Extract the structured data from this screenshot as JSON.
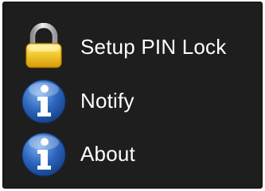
{
  "menu": {
    "items": [
      {
        "label": "Setup PIN Lock",
        "icon": "lock-icon"
      },
      {
        "label": "Notify",
        "icon": "info-icon"
      },
      {
        "label": "About",
        "icon": "info-icon"
      }
    ]
  },
  "colors": {
    "background": "#1e1e1e",
    "text": "#ffffff",
    "lock_body": "#f3c316",
    "lock_shackle": "#c9c9c9",
    "info_circle": "#2f67b8"
  }
}
